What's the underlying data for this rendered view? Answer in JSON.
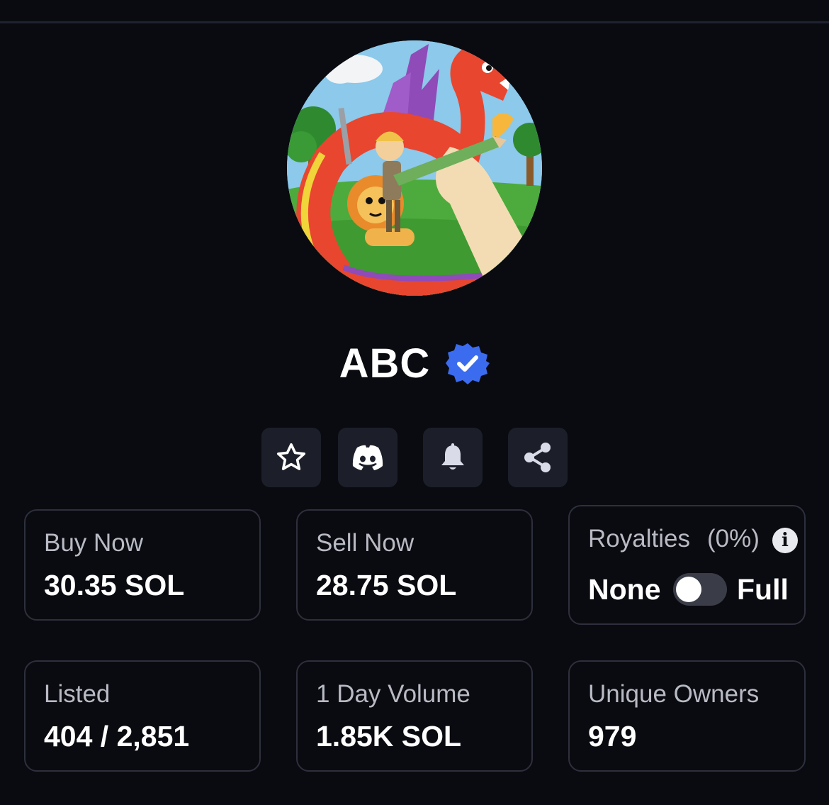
{
  "collection": {
    "name": "ABC",
    "verified": true
  },
  "actions": [
    {
      "name": "favorite",
      "icon": "star-icon"
    },
    {
      "name": "discord",
      "icon": "discord-icon"
    },
    {
      "name": "notifications",
      "icon": "bell-icon"
    },
    {
      "name": "share",
      "icon": "share-icon"
    }
  ],
  "stats": {
    "buy_now": {
      "label": "Buy Now",
      "value": "30.35 SOL"
    },
    "sell_now": {
      "label": "Sell Now",
      "value": "28.75 SOL"
    },
    "royalties": {
      "label": "Royalties",
      "percent": "(0%)",
      "info_icon": "i",
      "option_none": "None",
      "option_full": "Full",
      "toggle_state": "none"
    },
    "listed": {
      "label": "Listed",
      "value": "404 / 2,851"
    },
    "day_volume": {
      "label": "1 Day Volume",
      "value": "1.85K SOL"
    },
    "unique_owners": {
      "label": "Unique Owners",
      "value": "979"
    }
  },
  "colors": {
    "background": "#0a0b10",
    "card_border": "#2d303c",
    "button_bg": "#1c1f29",
    "verified_badge": "#3b6cf0"
  }
}
